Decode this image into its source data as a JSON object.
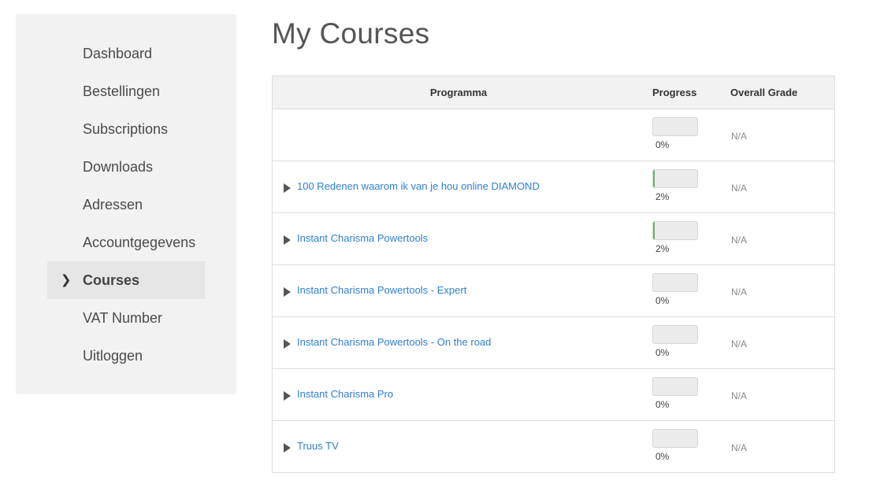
{
  "sidebar": {
    "items": [
      {
        "label": "Dashboard",
        "active": false
      },
      {
        "label": "Bestellingen",
        "active": false
      },
      {
        "label": "Subscriptions",
        "active": false
      },
      {
        "label": "Downloads",
        "active": false
      },
      {
        "label": "Adressen",
        "active": false
      },
      {
        "label": "Accountgegevens",
        "active": false
      },
      {
        "label": "Courses",
        "active": true
      },
      {
        "label": "VAT Number",
        "active": false
      },
      {
        "label": "Uitloggen",
        "active": false
      }
    ],
    "active_icon": "chevron-right-icon"
  },
  "main": {
    "title": "My Courses",
    "table": {
      "headers": {
        "program": "Programma",
        "progress": "Progress",
        "grade": "Overall Grade"
      },
      "rows": [
        {
          "name": "",
          "progress": 0,
          "progress_label": "0%",
          "grade": "N/A"
        },
        {
          "name": "100 Redenen waarom ik van je hou online DIAMOND",
          "progress": 2,
          "progress_label": "2%",
          "grade": "N/A"
        },
        {
          "name": "Instant Charisma Powertools",
          "progress": 2,
          "progress_label": "2%",
          "grade": "N/A"
        },
        {
          "name": "Instant Charisma Powertools - Expert",
          "progress": 0,
          "progress_label": "0%",
          "grade": "N/A"
        },
        {
          "name": "Instant Charisma Powertools - On the road",
          "progress": 0,
          "progress_label": "0%",
          "grade": "N/A"
        },
        {
          "name": "Instant Charisma Pro",
          "progress": 0,
          "progress_label": "0%",
          "grade": "N/A"
        },
        {
          "name": "Truus TV",
          "progress": 0,
          "progress_label": "0%",
          "grade": "N/A"
        }
      ]
    }
  },
  "colors": {
    "link": "#2f7fd1",
    "progress_fill": "#5cb85c",
    "sidebar_bg": "#f2f2f2",
    "active_item_bg": "#e6e6e6"
  }
}
